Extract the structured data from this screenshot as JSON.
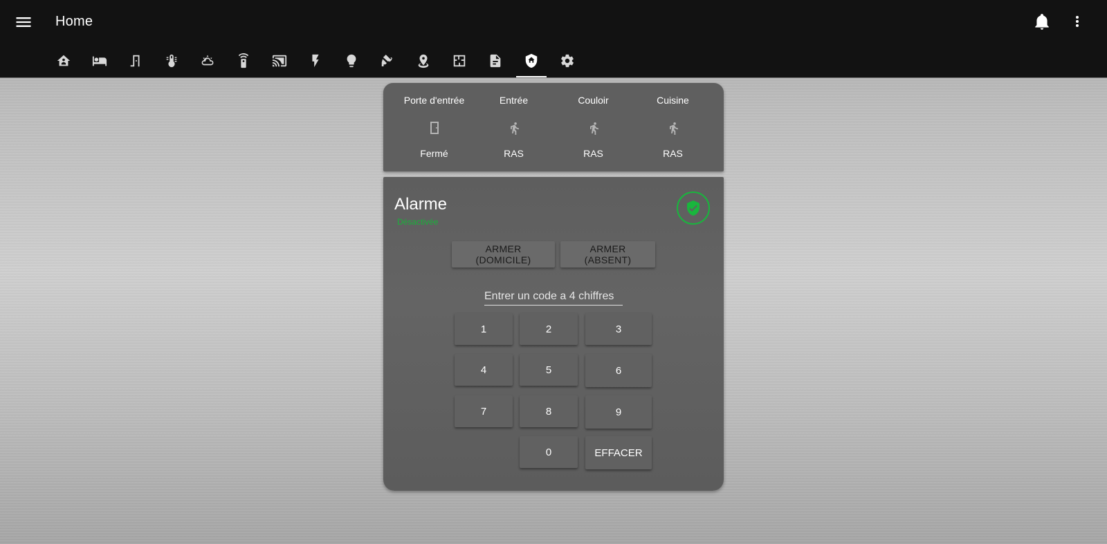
{
  "header": {
    "title": "Home",
    "icons": {
      "menu": "menu-icon",
      "notifications": "bell-icon",
      "more": "dots-vertical-icon"
    }
  },
  "tabs": [
    {
      "icon": "home-group-icon",
      "active": false
    },
    {
      "icon": "sofa-icon",
      "active": false
    },
    {
      "icon": "door-icon",
      "active": false
    },
    {
      "icon": "thermometer-icon",
      "active": false
    },
    {
      "icon": "weather-icon",
      "active": false
    },
    {
      "icon": "remote-icon",
      "active": false
    },
    {
      "icon": "cast-icon",
      "active": false
    },
    {
      "icon": "flash-icon",
      "active": false
    },
    {
      "icon": "lightbulb-icon",
      "active": false
    },
    {
      "icon": "cctv-icon",
      "active": false
    },
    {
      "icon": "map-marker-icon",
      "active": false
    },
    {
      "icon": "floor-plan-icon",
      "active": false
    },
    {
      "icon": "file-document-icon",
      "active": false
    },
    {
      "icon": "shield-home-icon",
      "active": true
    },
    {
      "icon": "cog-icon",
      "active": false
    }
  ],
  "sensors": [
    {
      "name": "Porte d'entrée",
      "state": "Fermé",
      "icon": "door-closed-icon"
    },
    {
      "name": "Entrée",
      "state": "RAS",
      "icon": "walk-icon"
    },
    {
      "name": "Couloir",
      "state": "RAS",
      "icon": "walk-icon"
    },
    {
      "name": "Cuisine",
      "state": "RAS",
      "icon": "walk-icon"
    }
  ],
  "alarm": {
    "title": "Alarme",
    "status": "Désactivée",
    "status_color": "#19b63d",
    "badge_icon": "shield-check-icon",
    "arm_home_label": "ARMER (DOMICILE)",
    "arm_away_label": "ARMER (ABSENT)",
    "code_placeholder": "Entrer un code a 4 chiffres",
    "code_value": "",
    "keys": [
      "1",
      "2",
      "3",
      "4",
      "5",
      "6",
      "7",
      "8",
      "9",
      "0"
    ],
    "clear_label": "EFFACER"
  },
  "colors": {
    "header_bg": "#121212",
    "card_bg": "#5f5f5f",
    "accent_green": "#19b63d"
  }
}
